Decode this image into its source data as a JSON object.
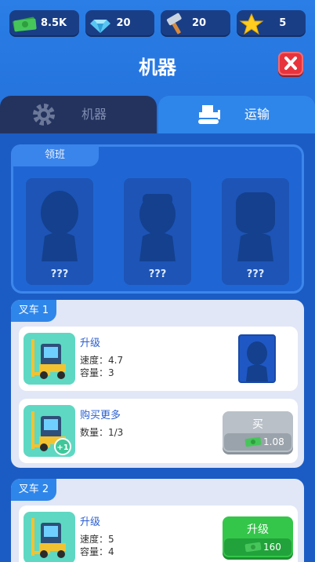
{
  "resources": [
    {
      "icon": "cash-icon",
      "value": "8.5K"
    },
    {
      "icon": "gem-icon",
      "value": "20"
    },
    {
      "icon": "hammer-icon",
      "value": "20"
    },
    {
      "icon": "star-icon",
      "value": "5"
    }
  ],
  "header": {
    "title": "机器"
  },
  "tabs": [
    {
      "label": "机器",
      "icon": "gear-icon",
      "active": false
    },
    {
      "label": "运输",
      "icon": "bulldozer-icon",
      "active": true
    }
  ],
  "foreman": {
    "tag": "领班",
    "slots": [
      {
        "label": "???"
      },
      {
        "label": "???"
      },
      {
        "label": "???"
      }
    ]
  },
  "forklifts": [
    {
      "tag": "叉车 1",
      "upgrade": {
        "heading": "升级",
        "speed": "速度：4.7",
        "capacity": "容量：3"
      },
      "buy_more": {
        "heading": "购买更多",
        "count": "数量：1/3",
        "badge": "+1",
        "button_label": "买",
        "price": "1.08"
      }
    },
    {
      "tag": "叉车 2",
      "upgrade": {
        "heading": "升级",
        "speed": "速度：5",
        "capacity": "容量：4",
        "button_label": "升级",
        "price": "160"
      }
    }
  ],
  "colors": {
    "accent_blue": "#2f86ea",
    "close_red": "#e8333c",
    "button_green": "#34c64a",
    "button_gray": "#b9c0c8"
  }
}
